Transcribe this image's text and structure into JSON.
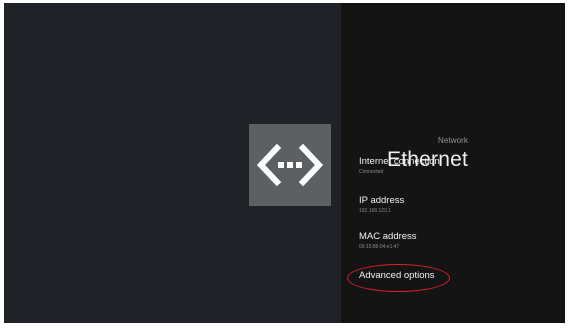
{
  "header": {
    "breadcrumb": "Network",
    "title": "Ethernet",
    "icon": "ethernet-icon"
  },
  "details": {
    "internet_connection": {
      "title": "Internet connection",
      "value": "Connected"
    },
    "ip_address": {
      "title": "IP address",
      "value": "192.168.123.1"
    },
    "mac_address": {
      "title": "MAC address",
      "value": "00:15:86:04:e1:47"
    },
    "advanced_options": {
      "title": "Advanced options"
    }
  },
  "colors": {
    "background": "#1d2125",
    "right_pane": "#141414",
    "icon_tile": "#5c6063",
    "highlight": "#e0202a"
  }
}
